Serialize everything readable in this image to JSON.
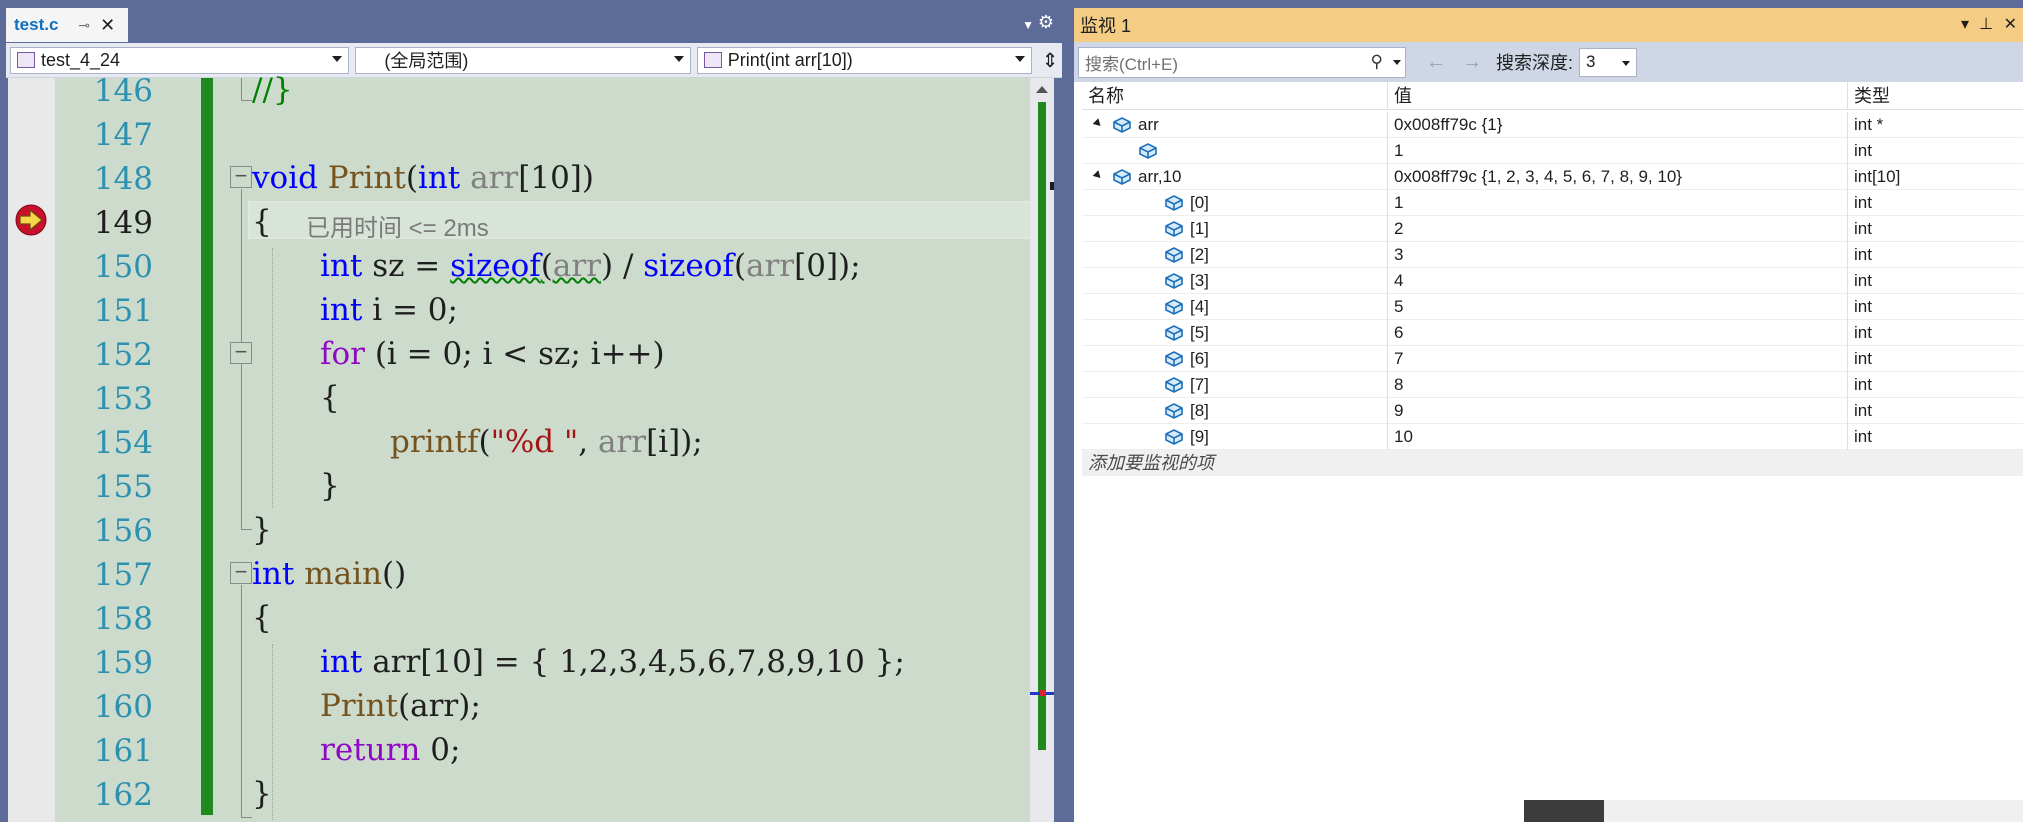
{
  "editor": {
    "tab": {
      "filename": "test.c",
      "pin_icon": "pin-icon",
      "close_icon": "close-icon"
    },
    "nav": {
      "project": "test_4_24",
      "scope": "(全局范围)",
      "function": "Print(int arr[10])"
    },
    "current_line": "149",
    "elapsed_hint": "已用时间 <= 2ms",
    "lines": [
      {
        "no": "146",
        "text": "//}"
      },
      {
        "no": "147",
        "text": ""
      },
      {
        "no": "148",
        "text": "void Print(int arr[10])"
      },
      {
        "no": "149",
        "text": "{"
      },
      {
        "no": "150",
        "text": "int sz = sizeof(arr) / sizeof(arr[0]);"
      },
      {
        "no": "151",
        "text": "int i = 0;"
      },
      {
        "no": "152",
        "text": "for (i = 0; i < sz; i++)"
      },
      {
        "no": "153",
        "text": "{"
      },
      {
        "no": "154",
        "text": "printf(\"%d \", arr[i]);"
      },
      {
        "no": "155",
        "text": "}"
      },
      {
        "no": "156",
        "text": "}"
      },
      {
        "no": "157",
        "text": "int main()"
      },
      {
        "no": "158",
        "text": "{"
      },
      {
        "no": "159",
        "text": "int arr[10] = { 1,2,3,4,5,6,7,8,9,10 };"
      },
      {
        "no": "160",
        "text": "Print(arr);"
      },
      {
        "no": "161",
        "text": "return 0;"
      },
      {
        "no": "162",
        "text": "}"
      }
    ]
  },
  "watch": {
    "title": "监视 1",
    "search_placeholder": "搜索(Ctrl+E)",
    "depth_label": "搜索深度:",
    "depth_value": "3",
    "columns": {
      "name": "名称",
      "value": "值",
      "type": "类型"
    },
    "rows": [
      {
        "name": "arr",
        "value": "0x008ff79c {1}",
        "type": "int *"
      },
      {
        "name": "",
        "value": "1",
        "type": "int"
      },
      {
        "name": "arr,10",
        "value": "0x008ff79c {1, 2, 3, 4, 5, 6, 7, 8, 9, 10}",
        "type": "int[10]"
      },
      {
        "name": "[0]",
        "value": "1",
        "type": "int"
      },
      {
        "name": "[1]",
        "value": "2",
        "type": "int"
      },
      {
        "name": "[2]",
        "value": "3",
        "type": "int"
      },
      {
        "name": "[3]",
        "value": "4",
        "type": "int"
      },
      {
        "name": "[4]",
        "value": "5",
        "type": "int"
      },
      {
        "name": "[5]",
        "value": "6",
        "type": "int"
      },
      {
        "name": "[6]",
        "value": "7",
        "type": "int"
      },
      {
        "name": "[7]",
        "value": "8",
        "type": "int"
      },
      {
        "name": "[8]",
        "value": "9",
        "type": "int"
      },
      {
        "name": "[9]",
        "value": "10",
        "type": "int"
      }
    ],
    "add_item": "添加要监视的项"
  },
  "colors": {
    "title_bar": "#f5cc84",
    "editor_bg": "#cddbcd",
    "chrome": "#5d6b99",
    "change_bar": "#1e8a1e"
  }
}
